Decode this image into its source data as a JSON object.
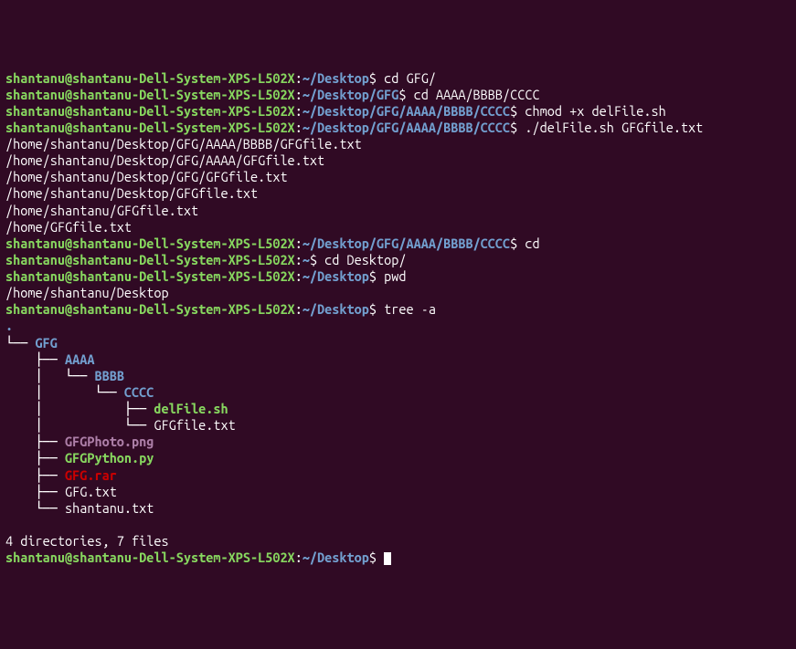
{
  "lines": [
    {
      "prompt": {
        "user": "shantanu@shantanu-Dell-System-XPS-L502X",
        "path": "~/Desktop"
      },
      "cmd": "cd GFG/"
    },
    {
      "prompt": {
        "user": "shantanu@shantanu-Dell-System-XPS-L502X",
        "path": "~/Desktop/GFG"
      },
      "cmd": "cd AAAA/BBBB/CCCC"
    },
    {
      "prompt": {
        "user": "shantanu@shantanu-Dell-System-XPS-L502X",
        "path": "~/Desktop/GFG/AAAA/BBBB/CCCC"
      },
      "cmd": "chmod +x delFile.sh"
    },
    {
      "prompt": {
        "user": "shantanu@shantanu-Dell-System-XPS-L502X",
        "path": "~/Desktop/GFG/AAAA/BBBB/CCCC"
      },
      "cmd": "./delFile.sh GFGfile.txt"
    },
    {
      "out": "/home/shantanu/Desktop/GFG/AAAA/BBBB/GFGfile.txt"
    },
    {
      "out": "/home/shantanu/Desktop/GFG/AAAA/GFGfile.txt"
    },
    {
      "out": "/home/shantanu/Desktop/GFG/GFGfile.txt"
    },
    {
      "out": "/home/shantanu/Desktop/GFGfile.txt"
    },
    {
      "out": "/home/shantanu/GFGfile.txt"
    },
    {
      "out": "/home/GFGfile.txt"
    },
    {
      "prompt": {
        "user": "shantanu@shantanu-Dell-System-XPS-L502X",
        "path": "~/Desktop/GFG/AAAA/BBBB/CCCC"
      },
      "cmd": "cd"
    },
    {
      "prompt": {
        "user": "shantanu@shantanu-Dell-System-XPS-L502X",
        "path": "~"
      },
      "cmd": "cd Desktop/"
    },
    {
      "prompt": {
        "user": "shantanu@shantanu-Dell-System-XPS-L502X",
        "path": "~/Desktop"
      },
      "cmd": "pwd"
    },
    {
      "out": "/home/shantanu/Desktop"
    },
    {
      "prompt": {
        "user": "shantanu@shantanu-Dell-System-XPS-L502X",
        "path": "~/Desktop"
      },
      "cmd": "tree -a"
    }
  ],
  "tree": {
    "root": ".",
    "rows": [
      {
        "branch": "└── ",
        "name": "GFG",
        "class": "dir"
      },
      {
        "branch": "    ├── ",
        "name": "AAAA",
        "class": "dir"
      },
      {
        "branch": "    │   └── ",
        "name": "BBBB",
        "class": "dir"
      },
      {
        "branch": "    │       └── ",
        "name": "CCCC",
        "class": "dir"
      },
      {
        "branch": "    │           ├── ",
        "name": "delFile.sh",
        "class": "exec"
      },
      {
        "branch": "    │           └── ",
        "name": "GFGfile.txt",
        "class": "white"
      },
      {
        "branch": "    ├── ",
        "name": "GFGPhoto.png",
        "class": "image"
      },
      {
        "branch": "    ├── ",
        "name": "GFGPython.py",
        "class": "exec"
      },
      {
        "branch": "    ├── ",
        "name": "GFG.rar",
        "class": "archive"
      },
      {
        "branch": "    ├── ",
        "name": "GFG.txt",
        "class": "white"
      },
      {
        "branch": "    └── ",
        "name": "shantanu.txt",
        "class": "white"
      }
    ],
    "summary": "4 directories, 7 files"
  },
  "final_prompt": {
    "user": "shantanu@shantanu-Dell-System-XPS-L502X",
    "path": "~/Desktop"
  }
}
